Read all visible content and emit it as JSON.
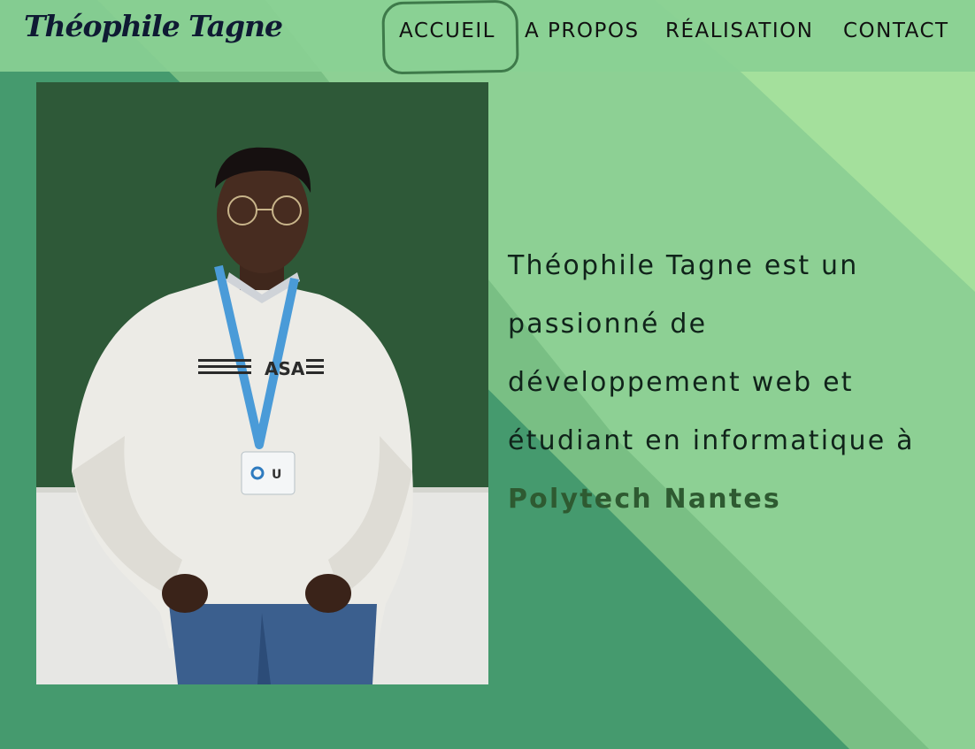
{
  "header": {
    "logo_text": "Théophile Tagne"
  },
  "nav": {
    "items": [
      {
        "label": "ACCUEIL"
      },
      {
        "label": "A PROPOS"
      },
      {
        "label": "RÉALISATION"
      },
      {
        "label": "CONTACT"
      }
    ],
    "active": "ACCUEIL"
  },
  "hero": {
    "bio_text": "Théophile Tagne est un passionné de développement web et étudiant en informatique à",
    "highlight": "Polytech Nantes"
  },
  "colors": {
    "bg_dark": "#459a6e",
    "bg_mid": "#79bf84",
    "bg_light": "#8dd094",
    "bg_lightest": "#a4e09c",
    "header": "#8ad094",
    "accent_ring": "#3e7a4a",
    "highlight": "#2e5a31",
    "text": "#10231a"
  }
}
